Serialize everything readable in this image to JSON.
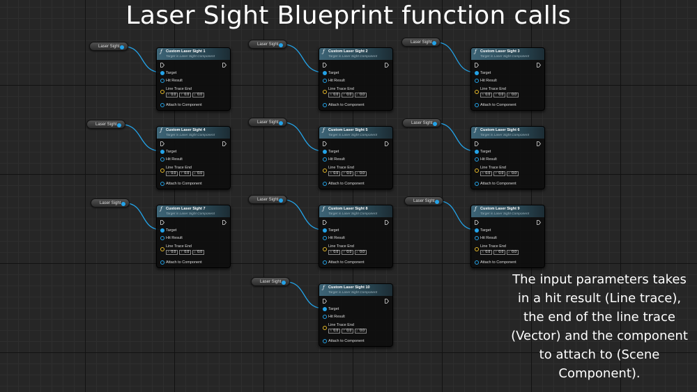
{
  "title": "Laser Sight Blueprint function calls",
  "description": "The input parameters takes in a hit result (Line trace), the end of the line trace (Vector) and the component to attach to (Scene Component).",
  "colors": {
    "object_pin": "#24a3e8",
    "vector_pin": "#e8bb2a",
    "node_header": "#3d6476",
    "background": "#262626"
  },
  "icons": {
    "function": "function-f-icon",
    "exec": "exec-arrow-icon"
  },
  "node_subtitle": "Target is Laser Sight Component",
  "pins": {
    "target": "Target",
    "hit_result": "Hit Result",
    "line_trace_end": "Line Trace End",
    "attach": "Attach to Component"
  },
  "vector_axes": [
    "X",
    "Y",
    "Z"
  ],
  "vector_values": [
    "0.0",
    "0.0",
    "0.0"
  ],
  "variable_label": "Laser Sight",
  "nodes": [
    {
      "title": "Custom Laser Sight 1"
    },
    {
      "title": "Custom Laser Sight 2"
    },
    {
      "title": "Custom Laser Sight 3"
    },
    {
      "title": "Custom Laser Sight 4"
    },
    {
      "title": "Custom Laser Sight 5"
    },
    {
      "title": "Custom Laser Sight 6"
    },
    {
      "title": "Custom Laser Sight 7"
    },
    {
      "title": "Custom Laser Sight 8"
    },
    {
      "title": "Custom Laser Sight 9"
    },
    {
      "title": "Custom Laser Sight 10"
    }
  ]
}
